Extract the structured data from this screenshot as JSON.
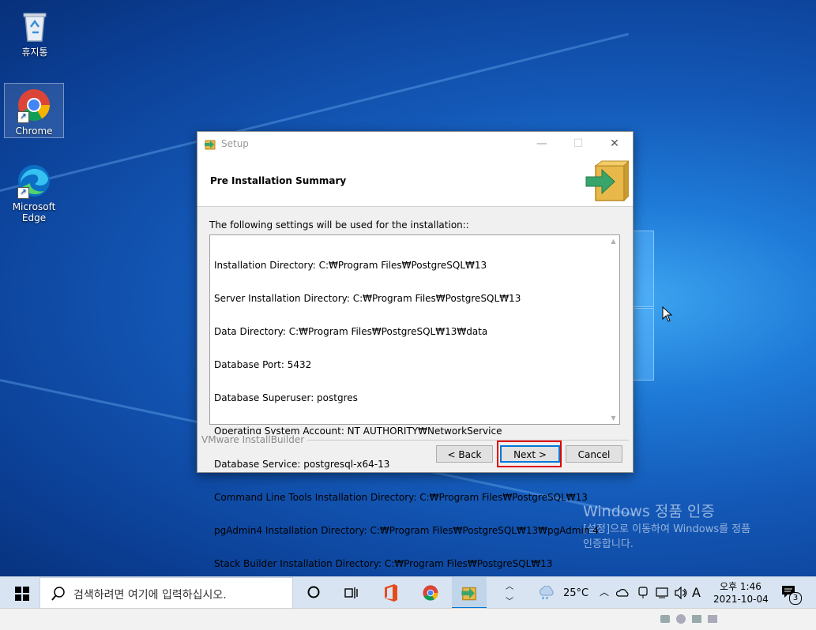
{
  "desktop": {
    "icons": [
      {
        "label": "휴지통"
      },
      {
        "label": "Chrome"
      },
      {
        "label": "Microsoft Edge"
      }
    ],
    "watermark": {
      "title": "Windows 정품 인증",
      "line1": "[설정]으로 이동하여 Windows를 정품",
      "line2": "인증합니다."
    }
  },
  "dialog": {
    "title": "Setup",
    "heading": "Pre Installation Summary",
    "intro": "The following settings will be used for the installation::",
    "summary_lines": [
      "Installation Directory: C:₩Program Files₩PostgreSQL₩13",
      "Server Installation Directory: C:₩Program Files₩PostgreSQL₩13",
      "Data Directory: C:₩Program Files₩PostgreSQL₩13₩data",
      "Database Port: 5432",
      "Database Superuser: postgres",
      "Operating System Account: NT AUTHORITY₩NetworkService",
      "Database Service: postgresql-x64-13",
      "Command Line Tools Installation Directory: C:₩Program Files₩PostgreSQL₩13",
      "pgAdmin4 Installation Directory: C:₩Program Files₩PostgreSQL₩13₩pgAdmin 4",
      "Stack Builder Installation Directory: C:₩Program Files₩PostgreSQL₩13"
    ],
    "brand": "VMware InstallBuilder",
    "buttons": {
      "back": "< Back",
      "next": "Next >",
      "cancel": "Cancel"
    },
    "window_controls": {
      "minimize": "—",
      "maximize": "☐",
      "close": "✕"
    }
  },
  "taskbar": {
    "search_placeholder": "검색하려면 여기에 입력하십시오.",
    "weather_temp": "25°C",
    "ime": "A",
    "clock_time": "오후 1:46",
    "clock_date": "2021-10-04",
    "notification_count": "3"
  },
  "colors": {
    "highlight": "#e00000",
    "accent": "#0078d7"
  }
}
